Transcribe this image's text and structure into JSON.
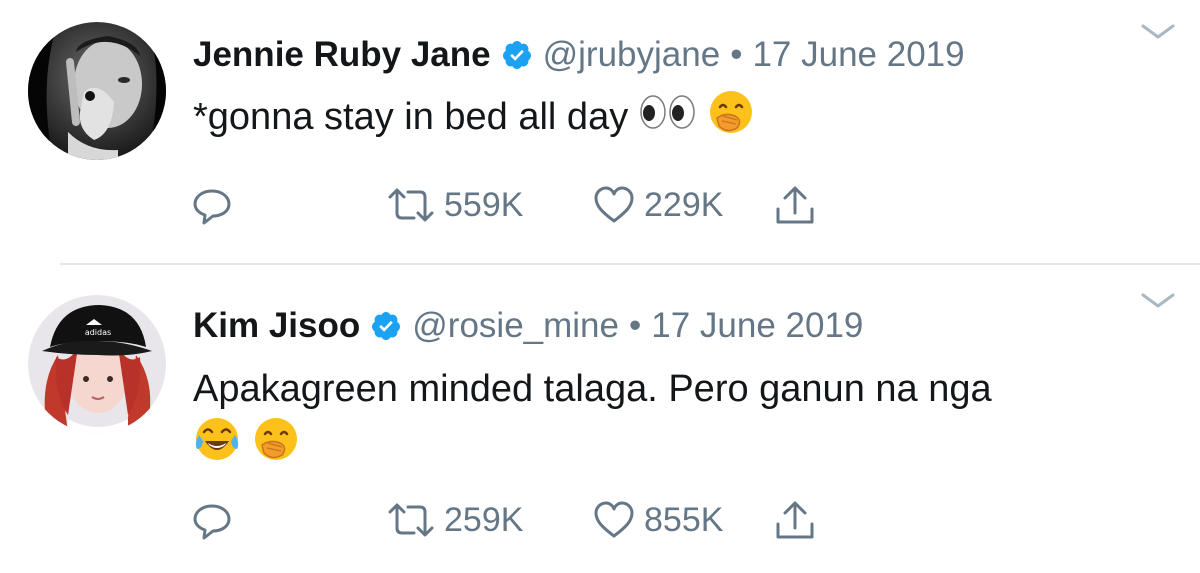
{
  "tweets": [
    {
      "display_name": "Jennie Ruby Jane",
      "handle": "@jrubyjane",
      "separator": "•",
      "date": "17 June 2019",
      "text": "*gonna stay in bed all day",
      "emojis": [
        "eyes-emoji",
        "face-with-hand-over-mouth-emoji"
      ],
      "retweets": "559K",
      "likes": "229K"
    },
    {
      "display_name": "Kim Jisoo",
      "handle": "@rosie_mine",
      "separator": "•",
      "date": "17 June 2019",
      "text": "Apakagreen minded talaga. Pero ganun na nga",
      "emojis": [
        "face-with-tears-of-joy-emoji",
        "face-with-hand-over-mouth-emoji"
      ],
      "retweets": "259K",
      "likes": "855K"
    }
  ],
  "colors": {
    "text": "#14171a",
    "secondary": "#657786",
    "verified": "#1da1f2",
    "divider": "#e3e6ea"
  }
}
